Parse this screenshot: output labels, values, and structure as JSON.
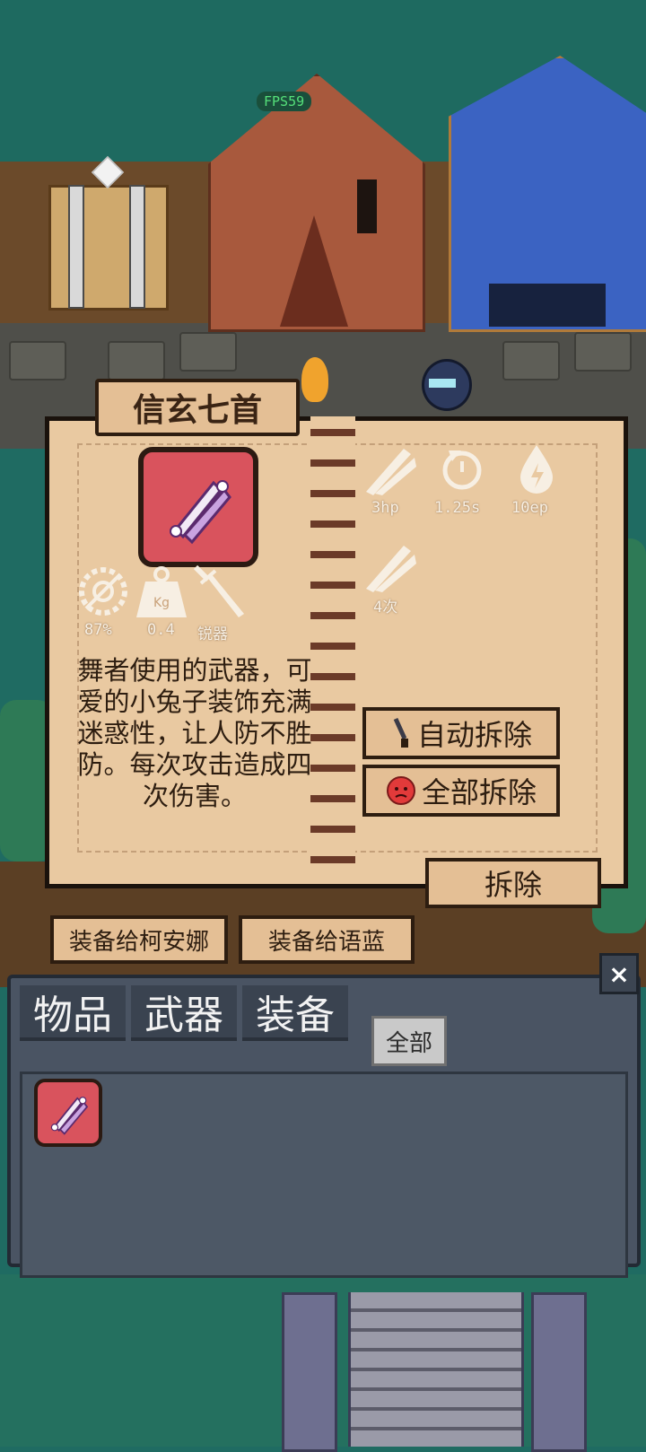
{
  "hud": {
    "fps": "FPS59"
  },
  "weapon": {
    "name": "信玄七首",
    "stats": [
      {
        "icon": "damage-icon",
        "label": "3hp"
      },
      {
        "icon": "cooldown-icon",
        "label": "1.25s"
      },
      {
        "icon": "energy-icon",
        "label": "10ep"
      },
      {
        "icon": "multi-hit-icon",
        "label": "4次"
      }
    ],
    "attributes": [
      {
        "icon": "gear-accuracy-icon",
        "label": "87%"
      },
      {
        "icon": "weight-icon",
        "label": "0.4"
      },
      {
        "icon": "sharp-blade-icon",
        "label": "锐器"
      }
    ],
    "weight_icon_text": "Kg",
    "description": "舞者使用的武器，可爱的小兔子装饰充满迷惑性，让人防不胜防。每次攻击造成四次伤害。"
  },
  "actions": {
    "auto_dismantle": "自动拆除",
    "dismantle_all": "全部拆除",
    "dismantle": "拆除",
    "equip_to_keanna": "装备给柯安娜",
    "equip_to_yulan": "装备给语蓝"
  },
  "inventory": {
    "tabs": [
      "物品",
      "武器",
      "装备"
    ],
    "filter": "全部",
    "close": "×"
  },
  "colors": {
    "tile_red": "#d9535d",
    "parchment": "#e9c9a1",
    "panel_dark": "#4a5463"
  }
}
